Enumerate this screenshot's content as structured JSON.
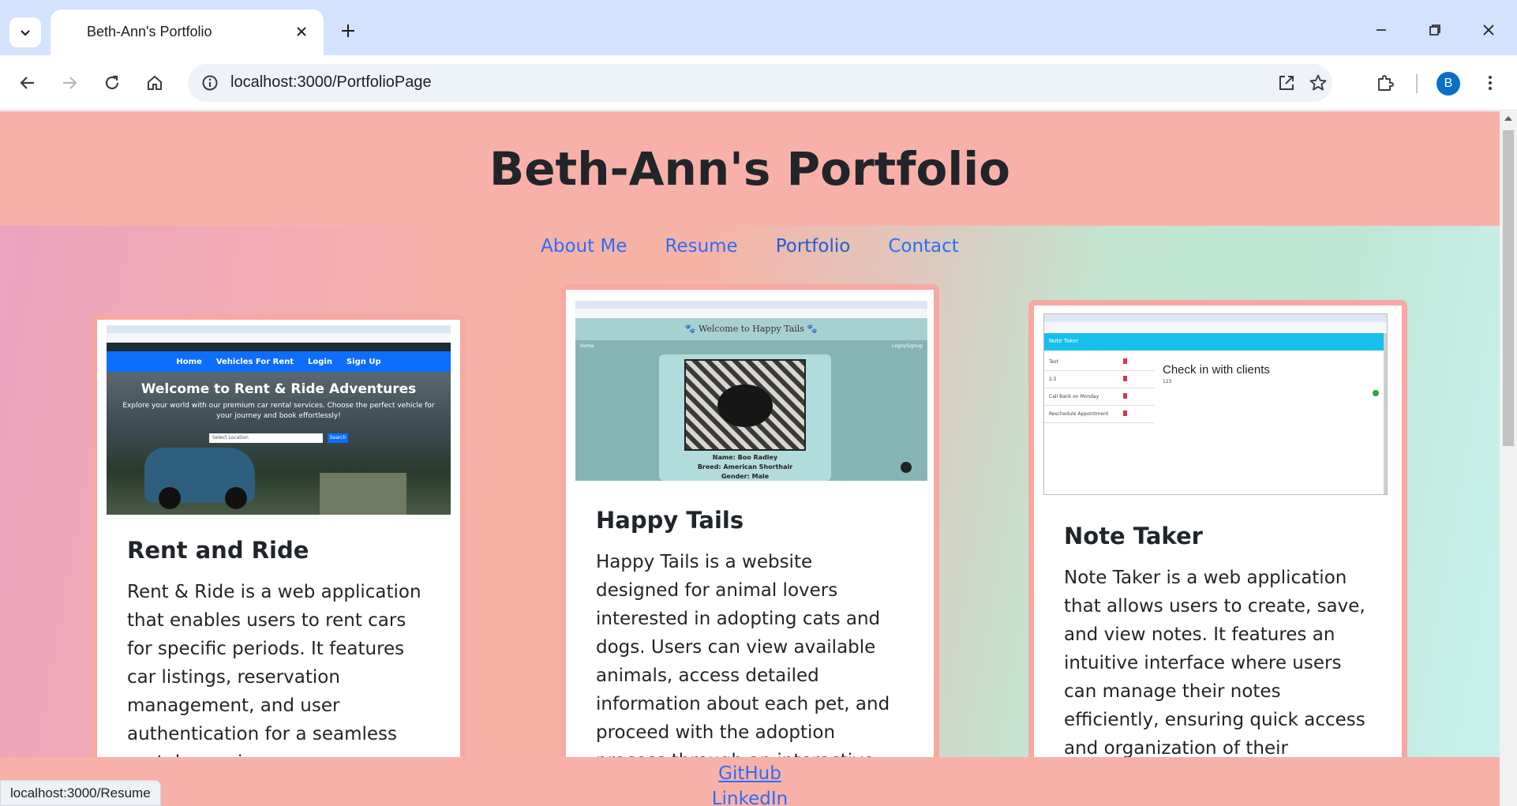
{
  "browser": {
    "tab_title": "Beth-Ann's Portfolio",
    "url": "localhost:3000/PortfolioPage",
    "profile_initial": "B",
    "status_url": "localhost:3000/Resume"
  },
  "site": {
    "title": "Beth-Ann's Portfolio",
    "nav": [
      "About Me",
      "Resume",
      "Portfolio",
      "Contact"
    ]
  },
  "projects": [
    {
      "title": "Rent and Ride",
      "description": "Rent & Ride is a web application that enables users to rent cars for specific periods. It features car listings, reservation management, and user authentication for a seamless rental experience.",
      "preview": {
        "nav": [
          "Home",
          "Vehicles For Rent",
          "Login",
          "Sign Up"
        ],
        "heading": "Welcome to Rent & Ride Adventures",
        "subheading": "Explore your world with our premium car rental services. Choose the perfect vehicle for your journey and book effortlessly!",
        "search_placeholder": "Select Location",
        "search_button": "Search"
      }
    },
    {
      "title": "Happy Tails",
      "description": "Happy Tails is a website designed for animal lovers interested in adopting cats and dogs. Users can view available animals, access detailed information about each pet, and proceed with the adoption process through an interactive, user-friendly interface.",
      "preview": {
        "heading": "🐾 Welcome to Happy Tails 🐾",
        "left_link": "Home",
        "right_link": "Login/Signup",
        "pet_name": "Name: Boo Radley",
        "pet_breed": "Breed: American Shorthair",
        "pet_gender": "Gender: Male"
      }
    },
    {
      "title": "Note Taker",
      "description": "Note Taker is a web application that allows users to create, save, and view notes. It features an intuitive interface where users can manage their notes efficiently, ensuring quick access and organization of their important information.",
      "preview": {
        "app_title": "Note Taker",
        "notes": [
          "Test",
          "2.5",
          "Call Bank on Monday",
          "Reschedule Appointment"
        ],
        "active_note_title": "Check in with clients",
        "active_note_text": "123"
      }
    }
  ],
  "footer": {
    "links": [
      "GitHub",
      "LinkedIn"
    ]
  }
}
